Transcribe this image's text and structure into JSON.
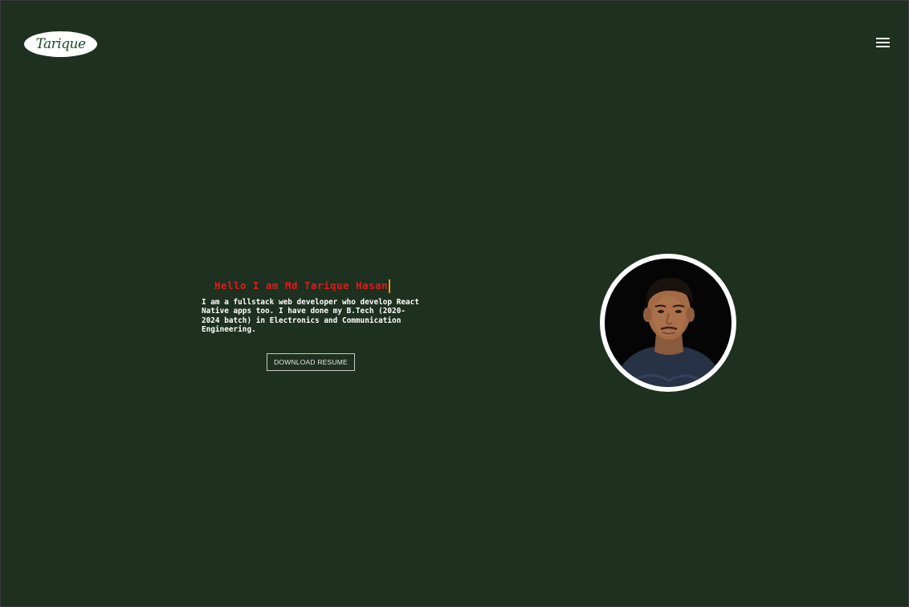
{
  "header": {
    "logo_text": "Tarique",
    "menu_icon": "hamburger-menu-icon"
  },
  "hero": {
    "greeting": "Hello I am Md Tarique Hasan",
    "bio": "I am a fullstack web developer who develop React Native apps too. I have done my B.Tech (2020-2024 batch) in Electronics and Communication Engineering.",
    "resume_button_label": "DOWNLOAD RESUME",
    "avatar_alt": "profile-photo"
  },
  "colors": {
    "background": "#1e301f",
    "greeting": "#e01b1b",
    "cursor": "#e3a21a",
    "text": "#ffffff"
  }
}
